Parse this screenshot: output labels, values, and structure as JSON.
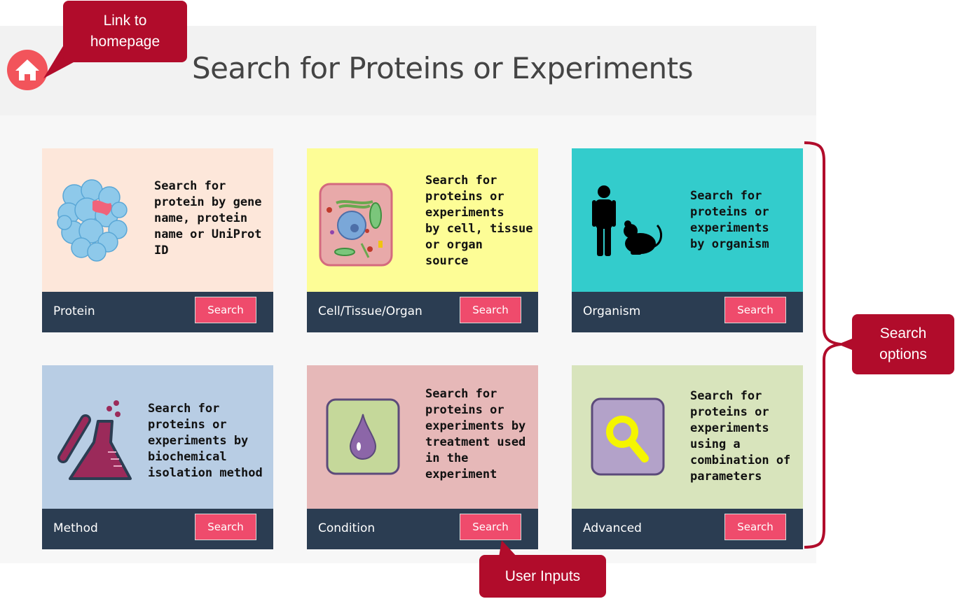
{
  "title": "Search for Proteins or Experiments",
  "home": {
    "icon": "home-icon"
  },
  "cards": [
    {
      "label": "Protein",
      "button": "Search",
      "description": "Search for\nprotein by gene\nname, protein\nname or UniProt\nID",
      "bg": "#fde7da",
      "icon": "protein-structure-icon"
    },
    {
      "label": "Cell/Tissue/Organ",
      "button": "Search",
      "description": "Search for\nproteins or\nexperiments\nby cell, tissue\nor organ\nsource",
      "bg": "#fdfd96",
      "icon": "cell-icon"
    },
    {
      "label": "Organism",
      "button": "Search",
      "description": "Search for\nproteins or\nexperiments\nby organism",
      "bg": "#33cccc",
      "icon": "human-mouse-icon"
    },
    {
      "label": "Method",
      "button": "Search",
      "description": "Search for\nproteins or\nexperiments by\nbiochemical\nisolation method",
      "bg": "#b8cde4",
      "icon": "flask-icon"
    },
    {
      "label": "Condition",
      "button": "Search",
      "description": "Search for\nproteins or\nexperiments by\ntreatment used\nin the\nexperiment",
      "bg": "#e6b8b8",
      "icon": "drop-icon"
    },
    {
      "label": "Advanced",
      "button": "Search",
      "description": "Search for\nproteins or\nexperiments\nusing a\ncombination of\nparameters",
      "bg": "#d8e4bc",
      "icon": "magnifier-icon"
    }
  ],
  "callouts": {
    "home": "Link to\nhomepage",
    "options": "Search\noptions",
    "inputs": "User Inputs"
  },
  "colors": {
    "accent": "#ef4b6c",
    "footer": "#2b3d52",
    "callout": "#b10c2b"
  }
}
